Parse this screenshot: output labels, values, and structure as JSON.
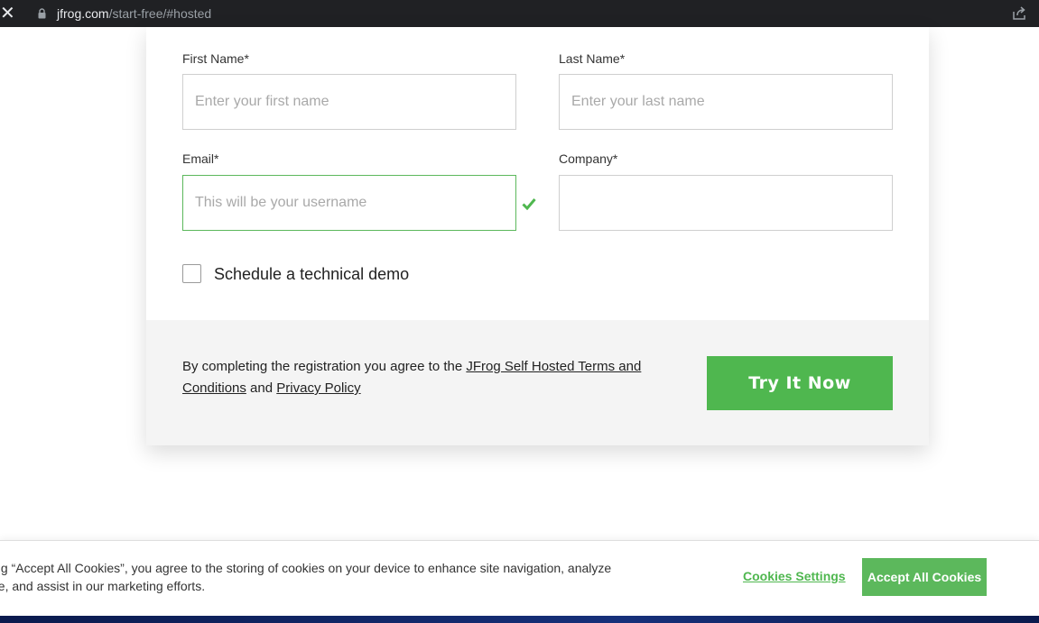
{
  "browser": {
    "url_domain": "jfrog.com",
    "url_path": "/start-free/#hosted",
    "close_glyph": "✕"
  },
  "form": {
    "first_name": {
      "label": "First Name*",
      "placeholder": "Enter your first name",
      "value": ""
    },
    "last_name": {
      "label": "Last Name*",
      "placeholder": "Enter your last name",
      "value": ""
    },
    "email": {
      "label": "Email*",
      "placeholder": "This will be your username",
      "value": "",
      "status": "valid"
    },
    "company": {
      "label": "Company*",
      "placeholder": "",
      "value": ""
    },
    "demo_checkbox": {
      "label": "Schedule a technical demo",
      "checked": false
    }
  },
  "footer": {
    "terms_prefix": "By completing the registration you agree to the ",
    "terms_link": "JFrog Self Hosted Terms and Conditions",
    "terms_and": " and ",
    "privacy_link": "Privacy Policy",
    "submit_label": "Try It Now"
  },
  "cookie_banner": {
    "text": "ing “Accept All Cookies”, you agree to the storing of cookies on your device to enhance site navigation, analyze ge, and assist in our marketing efforts.",
    "settings_label": "Cookies Settings",
    "accept_label": "Accept All Cookies"
  },
  "colors": {
    "accent_green": "#4fb74f",
    "browser_bar": "#202124",
    "footer_bg": "#f4f4f4"
  },
  "icons": [
    "close-icon",
    "lock-icon",
    "share-icon",
    "checkmark-icon"
  ]
}
